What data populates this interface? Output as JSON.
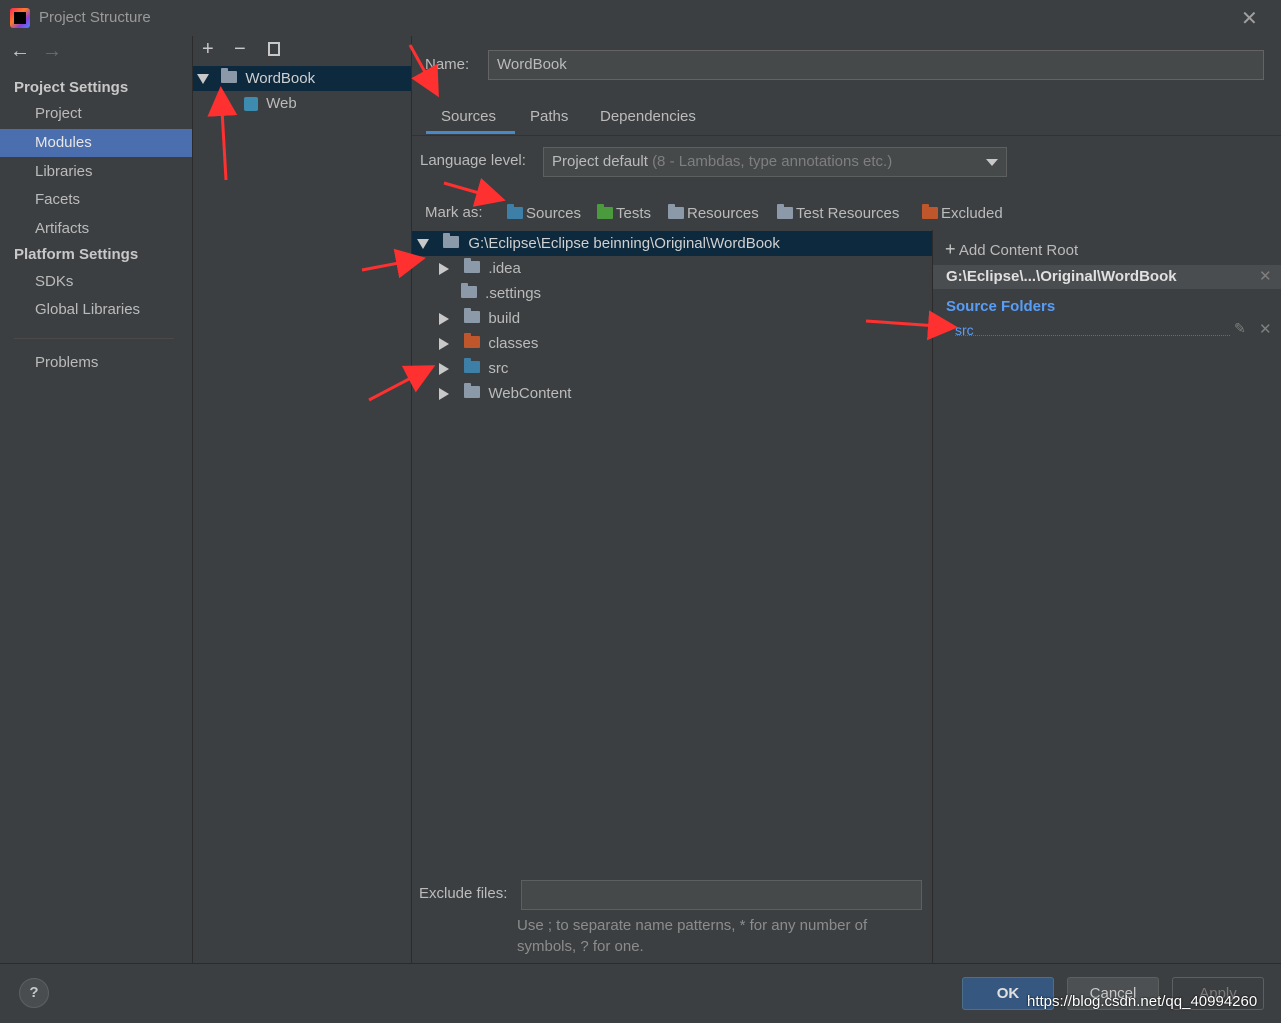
{
  "window": {
    "title": "Project Structure"
  },
  "nav": {
    "project_settings_header": "Project Settings",
    "platform_settings_header": "Platform Settings",
    "items": [
      {
        "label": "Project"
      },
      {
        "label": "Modules"
      },
      {
        "label": "Libraries"
      },
      {
        "label": "Facets"
      },
      {
        "label": "Artifacts"
      },
      {
        "label": "SDKs"
      },
      {
        "label": "Global Libraries"
      },
      {
        "label": "Problems"
      }
    ]
  },
  "modules": {
    "items": [
      {
        "label": "WordBook"
      },
      {
        "label": "Web"
      }
    ]
  },
  "module_detail": {
    "name_label": "Name:",
    "name_value": "WordBook",
    "tabs": [
      {
        "label": "Sources"
      },
      {
        "label": "Paths"
      },
      {
        "label": "Dependencies"
      }
    ],
    "language_level_label": "Language level:",
    "language_level_value": "Project default",
    "language_level_detail": "(8 - Lambdas, type annotations etc.)",
    "mark_as_label": "Mark as:",
    "mark_as": [
      {
        "label": "Sources",
        "color": "#3d7fa6"
      },
      {
        "label": "Tests",
        "color": "#4c9a3e"
      },
      {
        "label": "Resources",
        "color": "#8b99a8"
      },
      {
        "label": "Test Resources",
        "color": "#8b99a8"
      },
      {
        "label": "Excluded",
        "color": "#c0562c"
      }
    ]
  },
  "tree": {
    "root": "G:\\Eclipse\\Eclipse beinning\\Original\\WordBook",
    "children": [
      {
        "label": ".idea",
        "color": "#8b99a8"
      },
      {
        "label": ".settings",
        "color": "#8b99a8"
      },
      {
        "label": "build",
        "color": "#8b99a8"
      },
      {
        "label": "classes",
        "color": "#c0562c"
      },
      {
        "label": "src",
        "color": "#3d7fa6"
      },
      {
        "label": "WebContent",
        "color": "#8b99a8"
      }
    ]
  },
  "content_roots": {
    "add_label": "Add Content Root",
    "root_path": "G:\\Eclipse\\...\\Original\\WordBook",
    "source_folders_header": "Source Folders",
    "source_folders": [
      {
        "label": "src"
      }
    ]
  },
  "exclude": {
    "label": "Exclude files:",
    "value": "",
    "hint": "Use ; to separate name patterns, * for any number of symbols, ? for one."
  },
  "footer": {
    "help": "?",
    "ok": "OK",
    "cancel": "Cancel",
    "apply": "Apply"
  },
  "watermark": "https://blog.csdn.net/qq_40994260"
}
